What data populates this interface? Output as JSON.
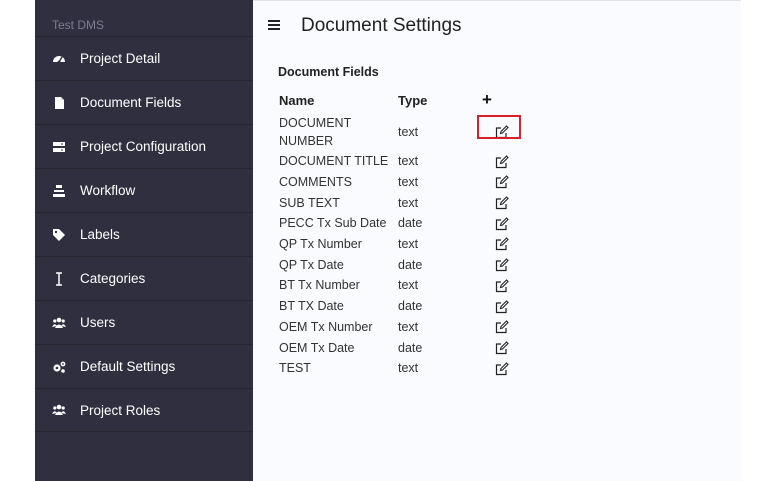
{
  "sidebar": {
    "app_title": "Test DMS",
    "items": [
      {
        "label": "Project Detail",
        "icon": "dashboard-icon"
      },
      {
        "label": "Document Fields",
        "icon": "file-icon"
      },
      {
        "label": "Project Configuration",
        "icon": "server-icon"
      },
      {
        "label": "Workflow",
        "icon": "workflow-icon"
      },
      {
        "label": "Labels",
        "icon": "tags-icon"
      },
      {
        "label": "Categories",
        "icon": "cursor-icon"
      },
      {
        "label": "Users",
        "icon": "users-icon"
      },
      {
        "label": "Default Settings",
        "icon": "gears-icon"
      },
      {
        "label": "Project Roles",
        "icon": "users-icon"
      }
    ]
  },
  "header": {
    "title": "Document Settings"
  },
  "document_fields": {
    "title": "Document Fields",
    "columns": {
      "name": "Name",
      "type": "Type",
      "add": "+"
    },
    "rows": [
      {
        "name": "DOCUMENT NUMBER",
        "type": "text"
      },
      {
        "name": "DOCUMENT TITLE",
        "type": "text"
      },
      {
        "name": "COMMENTS",
        "type": "text"
      },
      {
        "name": "SUB TEXT",
        "type": "text"
      },
      {
        "name": "PECC Tx Sub Date",
        "type": "date"
      },
      {
        "name": "QP Tx Number",
        "type": "text"
      },
      {
        "name": "QP Tx Date",
        "type": "date"
      },
      {
        "name": "BT Tx Number",
        "type": "text"
      },
      {
        "name": "BT TX Date",
        "type": "date"
      },
      {
        "name": "OEM Tx Number",
        "type": "text"
      },
      {
        "name": "OEM Tx Date",
        "type": "date"
      },
      {
        "name": "TEST",
        "type": "text"
      }
    ]
  },
  "colors": {
    "sidebar_bg": "#2f2f40",
    "main_bg": "#fafbfe",
    "highlight": "#d9202a"
  }
}
